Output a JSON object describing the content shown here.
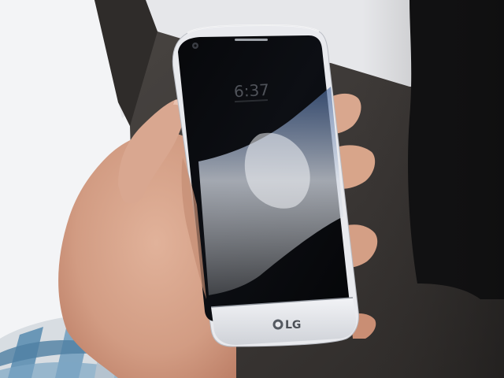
{
  "photo": {
    "subject": "hand-holding-phone",
    "phone": {
      "always_on_clock": "6:37",
      "brand_logo_text": "LG",
      "body_color": "#e9eaee",
      "screen_color": "#0b0c10"
    },
    "scene_colors": {
      "left_wall": "#f3f4f6",
      "back_wall": "#e9eaec",
      "floor": "#3b3836",
      "dark_clothing": "#0f0f10",
      "skin": "#d8a58a",
      "skin_shadow": "#b97a62",
      "shirt_blue": "#5e8fb2",
      "shirt_white": "#d8dde2"
    }
  }
}
